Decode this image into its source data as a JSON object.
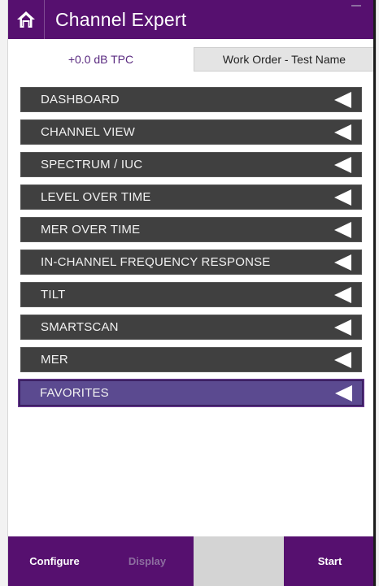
{
  "app": {
    "title": "Channel Expert"
  },
  "subbar": {
    "tpc_label": "+0.0 dB TPC",
    "work_order_label": "Work Order - Test Name"
  },
  "menu": {
    "items": [
      {
        "label": "DASHBOARD",
        "selected": false
      },
      {
        "label": "CHANNEL VIEW",
        "selected": false
      },
      {
        "label": "SPECTRUM / IUC",
        "selected": false
      },
      {
        "label": "LEVEL OVER TIME",
        "selected": false
      },
      {
        "label": "MER OVER TIME",
        "selected": false
      },
      {
        "label": "IN-CHANNEL FREQUENCY RESPONSE",
        "selected": false
      },
      {
        "label": "TILT",
        "selected": false
      },
      {
        "label": "SMARTSCAN",
        "selected": false
      },
      {
        "label": "MER",
        "selected": false
      },
      {
        "label": "FAVORITES",
        "selected": true
      }
    ]
  },
  "footer": {
    "configure_label": "Configure",
    "display_label": "Display",
    "start_label": "Start"
  },
  "colors": {
    "header": "#56106f",
    "menu_item": "#404040",
    "menu_selected": "#5b4a90",
    "footer": "#56106f"
  },
  "icons": {
    "home": "home-icon",
    "arrow": "triangle-left-icon"
  }
}
